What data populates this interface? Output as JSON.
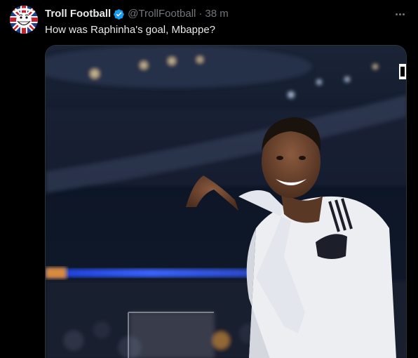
{
  "tweet": {
    "display_name": "Troll Football",
    "handle": "@TrollFootball",
    "separator": "·",
    "time": "38 m",
    "text": "How was Raphinha's goal, Mbappe?"
  },
  "icons": {
    "verified": "verified-badge-icon",
    "more": "more-options-icon"
  },
  "colors": {
    "background": "#000000",
    "primary_text": "#e7e9ea",
    "secondary_text": "#71767b",
    "verified_blue": "#1d9bf0",
    "border": "#2f3336"
  }
}
